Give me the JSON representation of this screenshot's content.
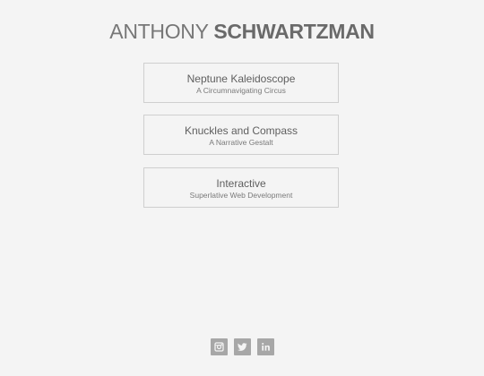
{
  "header": {
    "first_name": "ANTHONY",
    "last_name": "SCHWARTZMAN"
  },
  "projects": [
    {
      "title": "Neptune Kaleidoscope",
      "subtitle": "A Circumnavigating Circus"
    },
    {
      "title": "Knuckles and Compass",
      "subtitle": "A Narrative Gestalt"
    },
    {
      "title": "Interactive",
      "subtitle": "Superlative Web Development"
    }
  ],
  "social": [
    {
      "icon": "instagram-icon"
    },
    {
      "icon": "twitter-icon"
    },
    {
      "icon": "linkedin-icon"
    }
  ],
  "colors": {
    "background": "#f4f4f4",
    "card_border": "#cfcfcf",
    "icon_bg": "#a7a7a7"
  }
}
